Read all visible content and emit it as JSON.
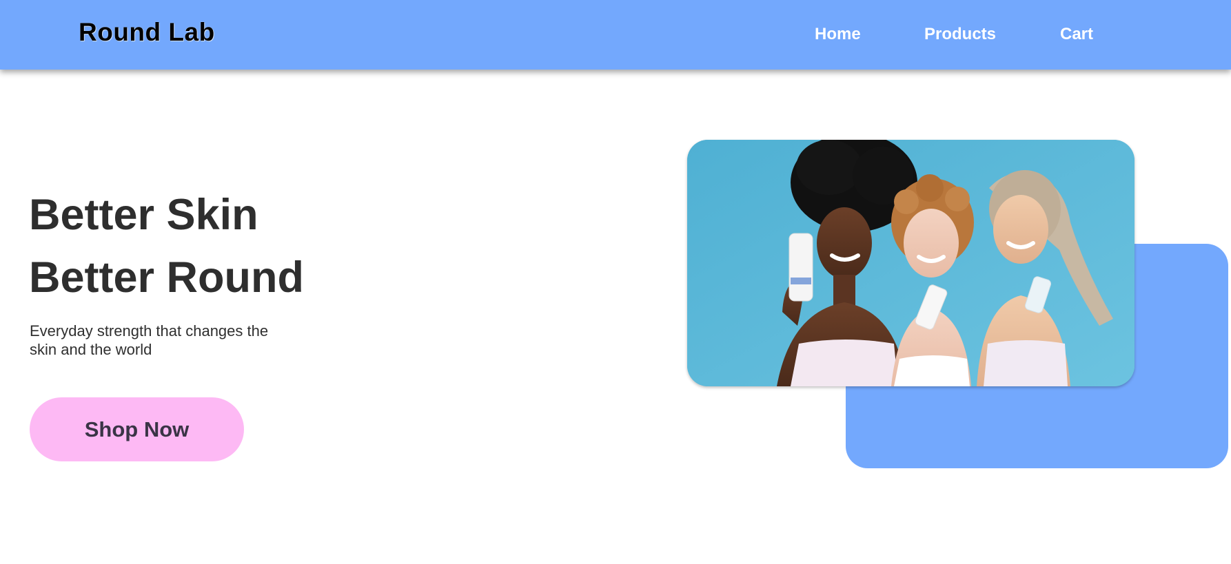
{
  "header": {
    "brand": "Round Lab",
    "nav": {
      "home": "Home",
      "products": "Products",
      "cart": "Cart"
    }
  },
  "hero": {
    "title_line1": "Better Skin",
    "title_line2": "Better Round",
    "subtitle": "Everyday strength that changes the skin and the world",
    "cta_label": "Shop Now",
    "image_subject": "three-women-holding-skincare-products-photo"
  },
  "colors": {
    "nav_background": "#73a8fd",
    "accent_block": "#73a8fd",
    "cta_background": "#fdb9f4",
    "heading_text": "#2e2e2e",
    "nav_text": "#ffffff"
  }
}
